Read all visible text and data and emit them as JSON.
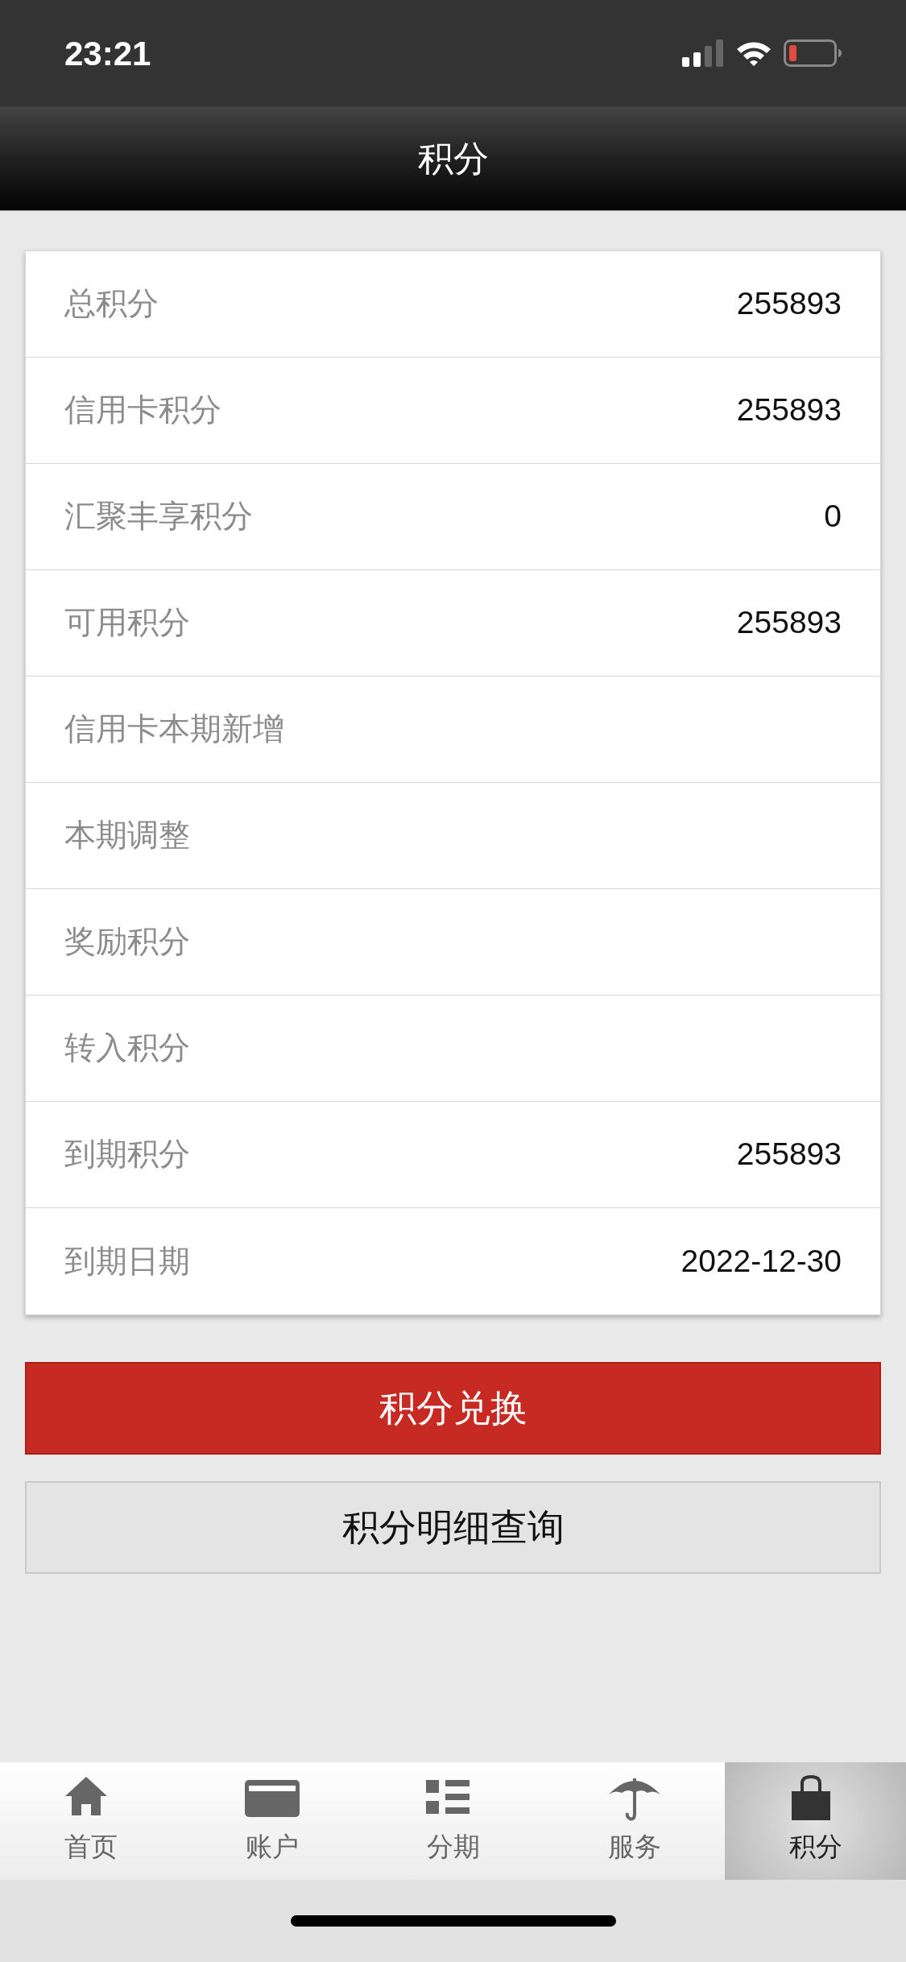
{
  "status_bar": {
    "time": "23:21"
  },
  "nav_bar": {
    "title": "积分"
  },
  "points": [
    {
      "label": "总积分",
      "value": "255893"
    },
    {
      "label": "信用卡积分",
      "value": "255893"
    },
    {
      "label": "汇聚丰享积分",
      "value": "0"
    },
    {
      "label": "可用积分",
      "value": "255893"
    },
    {
      "label": "信用卡本期新增"
    },
    {
      "label": "本期调整"
    },
    {
      "label": "奖励积分"
    },
    {
      "label": "转入积分"
    },
    {
      "label": "到期积分",
      "value": "255893"
    },
    {
      "label": "到期日期",
      "value": "2022-12-30"
    }
  ],
  "buttons": [
    {
      "label": "积分兑换",
      "kind": "primary"
    },
    {
      "label": "积分明细查询",
      "kind": "secondary"
    }
  ],
  "tab_bar": [
    {
      "label": "首页",
      "kind": "home",
      "selected": false
    },
    {
      "label": "账户",
      "kind": "card",
      "selected": false
    },
    {
      "label": "分期",
      "kind": "list",
      "selected": false
    },
    {
      "label": "服务",
      "kind": "umbrella",
      "selected": false
    },
    {
      "label": "积分",
      "kind": "bag",
      "selected": true
    }
  ]
}
